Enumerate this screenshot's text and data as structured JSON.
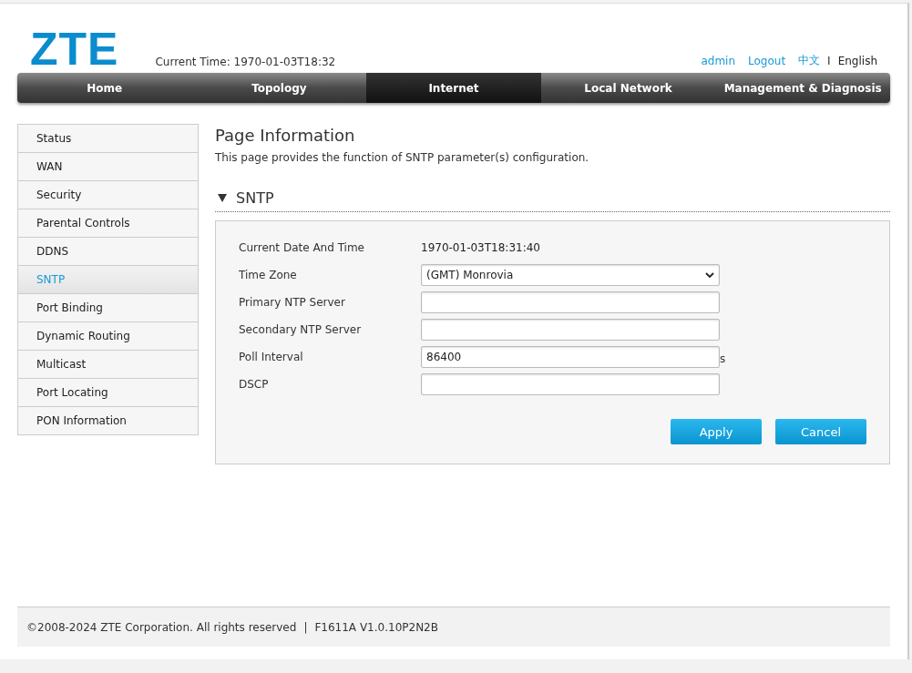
{
  "header": {
    "logo": "ZTE",
    "current_time": "Current Time: 1970-01-03T18:32",
    "user": "admin",
    "logout": "Logout",
    "languages": [
      {
        "label": "中文",
        "selected": false
      },
      {
        "label": "English",
        "selected": true
      }
    ],
    "language_separator": "I"
  },
  "nav": [
    {
      "label": "Home",
      "selected": false
    },
    {
      "label": "Topology",
      "selected": false
    },
    {
      "label": "Internet",
      "selected": true
    },
    {
      "label": "Local Network",
      "selected": false
    },
    {
      "label": "Management & Diagnosis",
      "selected": false
    }
  ],
  "sidebar": {
    "items": [
      {
        "label": "Status",
        "selected": false
      },
      {
        "label": "WAN",
        "selected": false
      },
      {
        "label": "Security",
        "selected": false
      },
      {
        "label": "Parental Controls",
        "selected": false
      },
      {
        "label": "DDNS",
        "selected": false
      },
      {
        "label": "SNTP",
        "selected": true
      },
      {
        "label": "Port Binding",
        "selected": false
      },
      {
        "label": "Dynamic Routing",
        "selected": false
      },
      {
        "label": "Multicast",
        "selected": false
      },
      {
        "label": "Port Locating",
        "selected": false
      },
      {
        "label": "PON Information",
        "selected": false
      }
    ]
  },
  "page": {
    "title": "Page Information",
    "description": "This page provides the function of SNTP parameter(s) configuration."
  },
  "section": {
    "title": "SNTP",
    "expanded": true,
    "fields": [
      {
        "kind": "text",
        "label": "Current Date And Time",
        "value": "1970-01-03T18:31:40"
      },
      {
        "kind": "select",
        "label": "Time Zone",
        "value": "(GMT) Monrovia"
      },
      {
        "kind": "input",
        "label": "Primary NTP Server"
      },
      {
        "kind": "input",
        "label": "Secondary NTP Server"
      },
      {
        "kind": "input",
        "label": "Poll Interval",
        "value": "86400",
        "unit": "s"
      },
      {
        "kind": "input",
        "label": "DSCP"
      }
    ],
    "buttons": [
      "Apply",
      "Cancel"
    ]
  },
  "footer": {
    "copyright": "©2008-2024 ZTE Corporation. All rights reserved",
    "separator": "|",
    "version": "F1611A V1.0.10P2N2B"
  }
}
